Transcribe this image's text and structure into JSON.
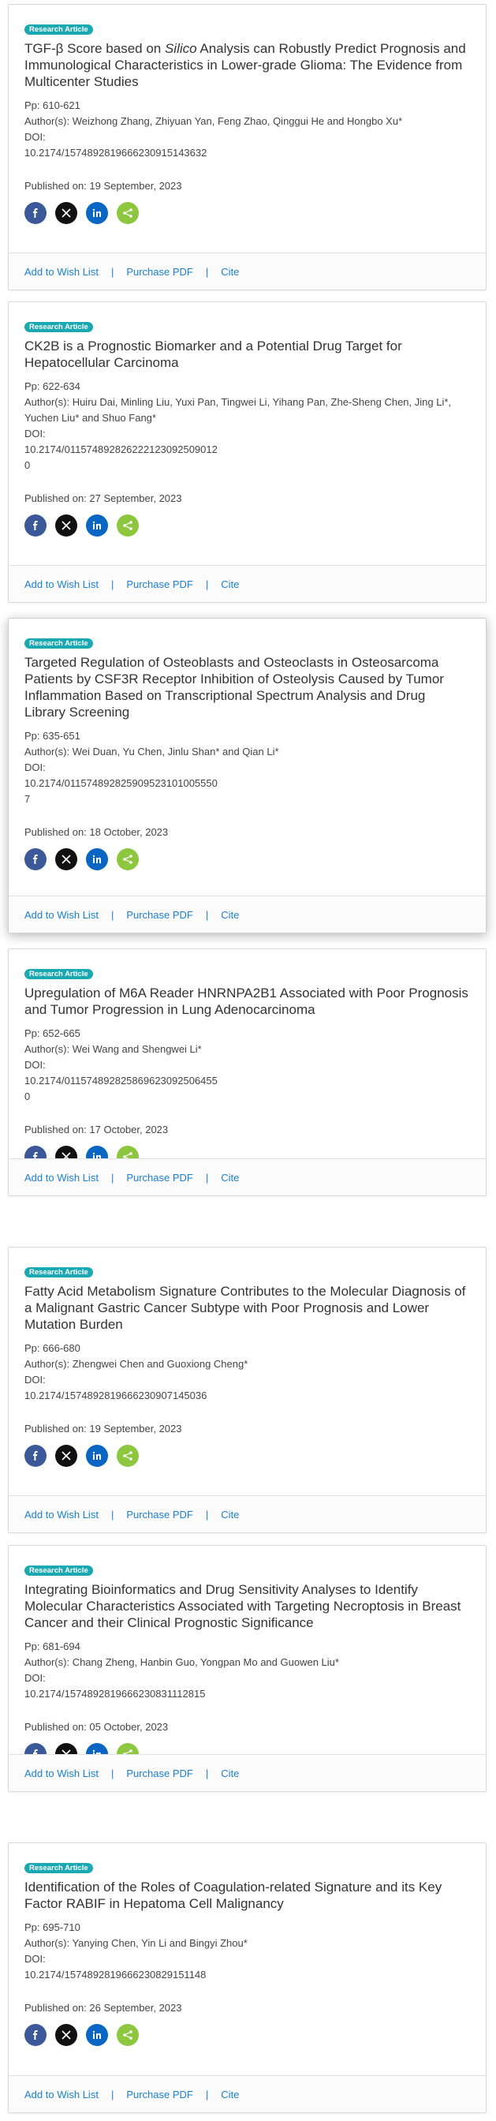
{
  "labels": {
    "pages_prefix": "Pp: ",
    "authors_prefix": "Author(s): ",
    "doi_label": "DOI:",
    "published_prefix": "Published on: ",
    "wish_list": "Add to Wish List",
    "purchase_pdf": "Purchase PDF",
    "cite": "Cite",
    "separator": "|"
  },
  "share_icons": [
    "facebook-icon",
    "x-icon",
    "linkedin-icon",
    "share-icon"
  ],
  "colors": {
    "badge": "#1aa9b3",
    "link": "#1a7fd0",
    "facebook": "#3b5998",
    "x": "#111111",
    "linkedin": "#0a66c2",
    "share": "#8dc63f"
  },
  "articles": [
    {
      "badge": "Research Article",
      "title_before": "TGF-β Score based on ",
      "title_em": "Silico",
      "title_after": " Analysis can Robustly Predict Prognosis and Immunological Characteristics in Lower-grade Glioma: The Evidence from Multicenter Studies",
      "pages": "610-621",
      "authors": "Weizhong Zhang, Zhiyuan Yan, Feng Zhao, Qinggui He and Hongbo Xu*",
      "doi": "10.2174/1574892819666230915143632",
      "doi_extra": "",
      "published": "19 September, 2023"
    },
    {
      "badge": "Research Article",
      "title_before": "CK2B is a Prognostic Biomarker and a Potential Drug Target for Hepatocellular Carcinoma",
      "title_em": "",
      "title_after": "",
      "pages": "622-634",
      "authors": "Huiru Dai, Minling Liu, Yuxi Pan, Tingwei Li, Yihang Pan, Zhe-Sheng Chen, Jing Li*, Yuchen Liu* and Shuo Fang*",
      "doi": "10.2174/011574892826222123092509012",
      "doi_extra": "0",
      "published": "27 September, 2023"
    },
    {
      "badge": "Research Article",
      "title_before": "Targeted Regulation of Osteoblasts and Osteoclasts in Osteosarcoma Patients by CSF3R Receptor Inhibition of Osteolysis Caused by Tumor Inflammation Based on Transcriptional Spectrum Analysis and Drug Library Screening",
      "title_em": "",
      "title_after": "",
      "pages": "635-651",
      "authors": "Wei Duan, Yu Chen, Jinlu Shan* and Qian Li*",
      "doi": "10.2174/011574892825909523101005550",
      "doi_extra": "7",
      "published": "18 October, 2023"
    },
    {
      "badge": "Research Article",
      "title_before": "Upregulation of M6A Reader HNRNPA2B1 Associated with Poor Prognosis and Tumor Progression in Lung Adenocarcinoma",
      "title_em": "",
      "title_after": "",
      "pages": "652-665",
      "authors": "Wei Wang and Shengwei Li*",
      "doi": "10.2174/011574892825869623092506455",
      "doi_extra": "0",
      "published": "17 October, 2023"
    },
    {
      "badge": "Research Article",
      "title_before": "Fatty Acid Metabolism Signature Contributes to the Molecular Diagnosis of a Malignant Gastric Cancer Subtype with Poor Prognosis and Lower Mutation Burden",
      "title_em": "",
      "title_after": "",
      "pages": "666-680",
      "authors": "Zhengwei Chen and Guoxiong Cheng*",
      "doi": "10.2174/1574892819666230907145036",
      "doi_extra": "",
      "published": "19 September, 2023"
    },
    {
      "badge": "Research Article",
      "title_before": "Integrating Bioinformatics and Drug Sensitivity Analyses to Identify Molecular Characteristics Associated with Targeting Necroptosis in Breast Cancer and their Clinical Prognostic Significance",
      "title_em": "",
      "title_after": "",
      "pages": "681-694",
      "authors": "Chang Zheng, Hanbin Guo, Yongpan Mo and Guowen Liu*",
      "doi": "10.2174/1574892819666230831112815",
      "doi_extra": "",
      "published": "05 October, 2023"
    },
    {
      "badge": "Research Article",
      "title_before": "Identification of the Roles of Coagulation-related Signature and its Key Factor RABIF in Hepatoma Cell Malignancy",
      "title_em": "",
      "title_after": "",
      "pages": "695-710",
      "authors": "Yanying Chen, Yin Li and Bingyi Zhou*",
      "doi": "10.2174/1574892819666230829151148",
      "doi_extra": "",
      "published": "26 September, 2023"
    }
  ]
}
